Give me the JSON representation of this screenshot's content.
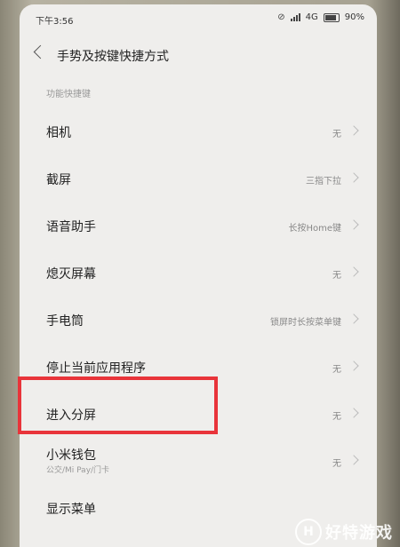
{
  "status_bar": {
    "time": "下午3:56",
    "network": "4G",
    "battery": "90%"
  },
  "header": {
    "title": "手势及按键快捷方式"
  },
  "section": {
    "title": "功能快捷键"
  },
  "items": [
    {
      "label": "相机",
      "value": "无"
    },
    {
      "label": "截屏",
      "value": "三指下拉"
    },
    {
      "label": "语音助手",
      "value": "长按Home键"
    },
    {
      "label": "熄灭屏幕",
      "value": "无"
    },
    {
      "label": "手电筒",
      "value": "锁屏时长按菜单键"
    },
    {
      "label": "停止当前应用程序",
      "value": "无"
    },
    {
      "label": "进入分屏",
      "value": "无"
    },
    {
      "label": "小米钱包",
      "sublabel": "公交/Mi Pay/门卡",
      "value": "无"
    },
    {
      "label": "显示菜单",
      "value": ""
    }
  ],
  "watermark": {
    "logo_letter": "H",
    "text": "好特游戏"
  },
  "colors": {
    "highlight": "#e8343a",
    "screen_bg": "#efeeec"
  }
}
